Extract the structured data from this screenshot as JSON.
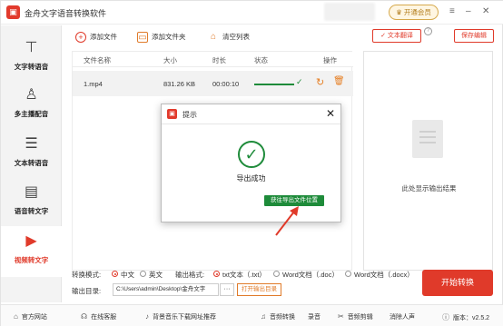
{
  "app": {
    "title": "金舟文字语音转换软件",
    "logo_char": "◼",
    "vip_label": "开通会员"
  },
  "titlebar_icons": {
    "menu": "≡",
    "minimize": "–",
    "maximize": "☐",
    "close": "✕"
  },
  "sidebar": {
    "items": [
      {
        "label": "文字转语音",
        "icon": "T",
        "active": false
      },
      {
        "label": "多主播配音",
        "icon": "♙",
        "active": false
      },
      {
        "label": "文本转语音",
        "icon": "☰",
        "active": false
      },
      {
        "label": "语音转文字",
        "icon": "▤",
        "active": false
      },
      {
        "label": "视频转文字",
        "icon": "▶",
        "active": true
      }
    ]
  },
  "toolbar": {
    "add_file": "添加文件",
    "add_folder": "添加文件夹",
    "clear_list": "清空列表",
    "text_translate": "文本翻译",
    "save_edit": "保存编辑",
    "help": "?"
  },
  "table": {
    "headers": [
      "文件名称",
      "大小",
      "时长",
      "状态",
      "操作"
    ],
    "rows": [
      {
        "name": "1.mp4",
        "size": "831.26 KB",
        "duration": "00:00:10",
        "progress": 1.0
      }
    ]
  },
  "preview": {
    "placeholder": "此处显示输出结果"
  },
  "options": {
    "mode_label": "转换模式:",
    "modes": [
      "中文",
      "英文"
    ],
    "mode_selected": "中文",
    "format_label": "输出格式:",
    "formats": [
      "txt文本（.txt）",
      "Word文档（.doc）",
      "Word文档（.docx）"
    ],
    "format_selected": "txt文本（.txt）",
    "dir_label": "输出目录:",
    "dir_value": "C:\\Users\\admin\\Desktop\\金舟文字",
    "more": "···",
    "open_dir": "打开输出目录"
  },
  "start_button": "开始转换",
  "footer": {
    "items": [
      "官方网站",
      "在线客服",
      "背景音乐下载网址推荐",
      "音频转换",
      "录音",
      "音频剪辑",
      "消除人声"
    ],
    "version": "版本：v2.5.2"
  },
  "dialog": {
    "title": "提示",
    "message": "导出成功",
    "button": "获往导出文件位置"
  },
  "colors": {
    "accent": "#e03a2a",
    "success": "#1e8b3a",
    "orange": "#e67e22"
  }
}
